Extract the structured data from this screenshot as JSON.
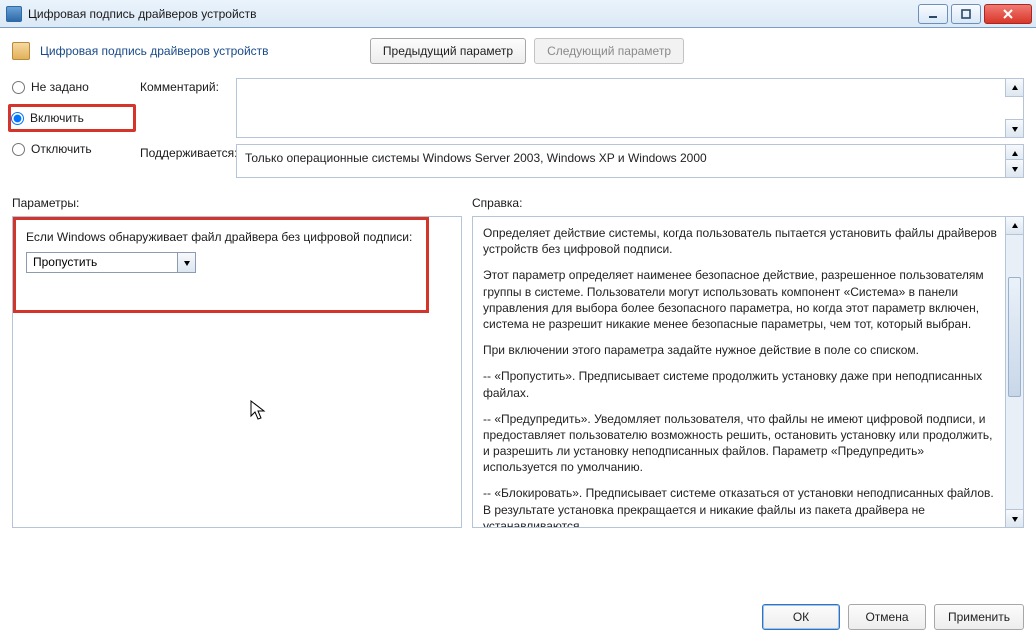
{
  "window": {
    "title": "Цифровая подпись драйверов устройств"
  },
  "header": {
    "title": "Цифровая подпись драйверов устройств"
  },
  "nav": {
    "prev": "Предыдущий параметр",
    "next": "Следующий параметр"
  },
  "state": {
    "not_configured": "Не задано",
    "enabled": "Включить",
    "disabled": "Отключить",
    "selected": "enabled"
  },
  "labels": {
    "comment": "Комментарий:",
    "supported": "Поддерживается:",
    "parameters": "Параметры:",
    "help": "Справка:"
  },
  "supported_text": "Только операционные системы Windows Server 2003, Windows XP и Windows 2000",
  "params": {
    "prompt": "Если Windows обнаруживает файл драйвера без цифровой подписи:",
    "selected": "Пропустить"
  },
  "help": {
    "p1": "Определяет действие системы, когда пользователь пытается установить файлы драйверов устройств без цифровой подписи.",
    "p2": "Этот параметр определяет наименее безопасное действие, разрешенное пользователям группы в системе. Пользователи могут использовать компонент «Система» в панели управления для выбора более безопасного параметра, но когда этот параметр включен, система не разрешит никакие менее безопасные параметры, чем тот, который выбран.",
    "p3": "При включении этого параметра задайте нужное действие в поле со списком.",
    "p4": "--   «Пропустить». Предписывает системе продолжить установку даже при неподписанных файлах.",
    "p5": "--   «Предупредить». Уведомляет пользователя, что файлы не имеют цифровой подписи, и предоставляет пользователю возможность решить, остановить установку или продолжить, и разрешить ли установку неподписанных файлов. Параметр «Предупредить» используется по умолчанию.",
    "p6": "--   «Блокировать». Предписывает системе отказаться от установки неподписанных файлов. В результате установка прекращается и никакие файлы из пакета драйвера не устанавливаются."
  },
  "footer": {
    "ok": "ОК",
    "cancel": "Отмена",
    "apply": "Применить"
  }
}
